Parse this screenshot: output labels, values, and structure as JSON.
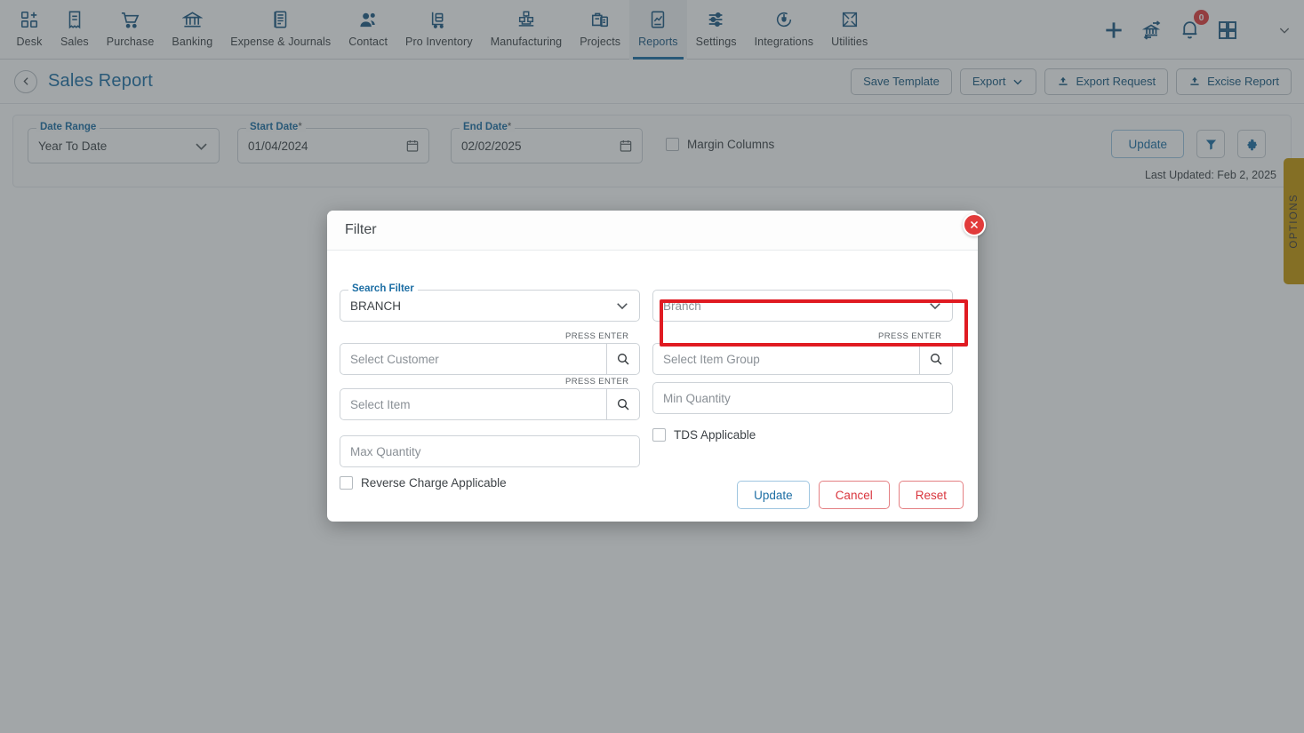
{
  "nav": {
    "items": [
      {
        "label": "Desk",
        "icon": "desk-grid-plus-icon",
        "active": false
      },
      {
        "label": "Sales",
        "icon": "receipt-icon",
        "active": false
      },
      {
        "label": "Purchase",
        "icon": "shopping-cart-icon",
        "active": false
      },
      {
        "label": "Banking",
        "icon": "bank-icon",
        "active": false
      },
      {
        "label": "Expense & Journals",
        "icon": "journal-book-icon",
        "active": false
      },
      {
        "label": "Contact",
        "icon": "people-icon",
        "active": false
      },
      {
        "label": "Pro Inventory",
        "icon": "inventory-cart-icon",
        "active": false
      },
      {
        "label": "Manufacturing",
        "icon": "factory-icon",
        "active": false
      },
      {
        "label": "Projects",
        "icon": "projects-briefcase-icon",
        "active": false
      },
      {
        "label": "Reports",
        "icon": "report-chart-icon",
        "active": true
      },
      {
        "label": "Settings",
        "icon": "sliders-icon",
        "active": false
      },
      {
        "label": "Integrations",
        "icon": "plug-icon",
        "active": false
      },
      {
        "label": "Utilities",
        "icon": "utilities-icon",
        "active": false
      }
    ],
    "right": {
      "add_icon": "plus-icon",
      "transfer_icon": "bank-transfer-icon",
      "notifications_icon": "bell-icon",
      "notifications_count": "0",
      "apps_icon": "grid-apps-icon",
      "chevron_icon": "chevron-down-icon"
    }
  },
  "header": {
    "back_icon": "chevron-left-icon",
    "title": "Sales Report",
    "actions": [
      {
        "label": "Save Template",
        "icon": null
      },
      {
        "label": "Export",
        "icon": "chevron-down-icon"
      },
      {
        "label": "Export Request",
        "icon": "download-icon"
      },
      {
        "label": "Excise Report",
        "icon": "download-icon"
      }
    ]
  },
  "filter_bar": {
    "date_range": {
      "label": "Date Range",
      "value": "Year To Date",
      "icon": "chevron-down-icon"
    },
    "start_date": {
      "label": "Start Date",
      "required": "*",
      "value": "01/04/2024",
      "icon": "calendar-icon"
    },
    "end_date": {
      "label": "End Date",
      "required": "*",
      "value": "02/02/2025",
      "icon": "calendar-icon"
    },
    "margin_columns": {
      "label": "Margin Columns",
      "checked": false
    },
    "update_label": "Update",
    "filter_icon": "funnel-icon",
    "settings_icon": "gear-icon",
    "last_updated": "Last Updated: Feb 2, 2025"
  },
  "options_tab": {
    "label": "OPTIONS",
    "color": "#c79708"
  },
  "modal": {
    "title": "Filter",
    "close_icon": "close-x-icon",
    "fields": {
      "search_filter": {
        "label": "Search Filter",
        "value": "BRANCH",
        "icon": "chevron-down-icon"
      },
      "branch": {
        "placeholder": "Branch",
        "icon": "chevron-down-icon"
      },
      "customer": {
        "placeholder": "Select Customer",
        "hint": "PRESS ENTER",
        "icon": "search-icon"
      },
      "item_group": {
        "placeholder": "Select Item Group",
        "hint": "PRESS ENTER",
        "icon": "search-icon",
        "highlighted": true
      },
      "item": {
        "placeholder": "Select Item",
        "hint": "PRESS ENTER",
        "icon": "search-icon"
      },
      "min_quantity": {
        "placeholder": "Min Quantity"
      },
      "max_quantity": {
        "placeholder": "Max Quantity"
      },
      "tds_applicable": {
        "label": "TDS Applicable",
        "checked": false
      },
      "reverse_charge": {
        "label": "Reverse Charge Applicable",
        "checked": false
      }
    },
    "buttons": {
      "update": "Update",
      "cancel": "Cancel",
      "reset": "Reset"
    }
  },
  "colors": {
    "accent_blue": "#1c6ea4",
    "danger_red": "#e23b3b",
    "highlight_red": "#e01b22",
    "options_gold": "#c79708",
    "overlay": "#8c9194"
  }
}
